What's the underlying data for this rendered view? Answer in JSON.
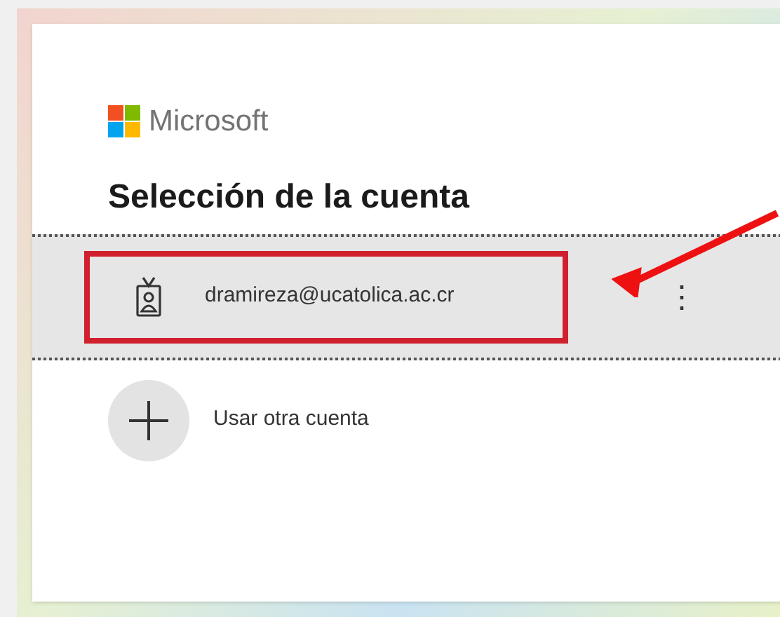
{
  "brand": "Microsoft",
  "heading": "Selección de la cuenta",
  "accounts": [
    {
      "email": "dramireza@ucatolica.ac.cr",
      "selected": true,
      "more": "⋮"
    }
  ],
  "other_account": {
    "label": "Usar otra cuenta"
  }
}
